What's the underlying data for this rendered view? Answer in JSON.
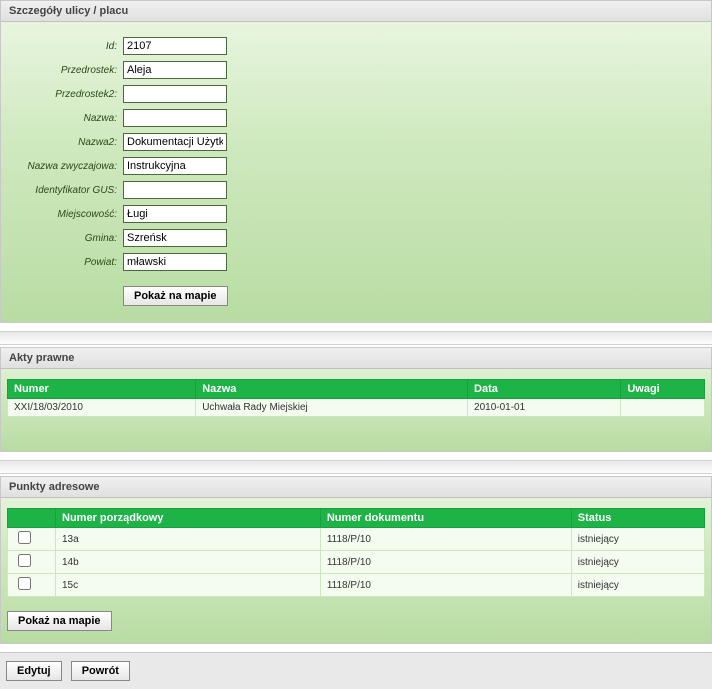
{
  "details": {
    "header": "Szczegóły ulicy / placu",
    "fields": {
      "id": {
        "label": "Id:",
        "value": "2107"
      },
      "prefix": {
        "label": "Przedrostek:",
        "value": "Aleja"
      },
      "prefix2": {
        "label": "Przedrostek2:",
        "value": ""
      },
      "name": {
        "label": "Nazwa:",
        "value": ""
      },
      "name2": {
        "label": "Nazwa2:",
        "value": "Dokumentacji Użytkowni"
      },
      "common": {
        "label": "Nazwa zwyczajowa:",
        "value": "Instrukcyjna"
      },
      "gus": {
        "label": "Identyfikator GUS:",
        "value": ""
      },
      "locality": {
        "label": "Miejscowość:",
        "value": "Ługi"
      },
      "gmina": {
        "label": "Gmina:",
        "value": "Szreńsk"
      },
      "powiat": {
        "label": "Powiat:",
        "value": "mławski"
      }
    },
    "show_map": "Pokaż na mapie"
  },
  "acts": {
    "header": "Akty prawne",
    "columns": {
      "numer": "Numer",
      "nazwa": "Nazwa",
      "data": "Data",
      "uwagi": "Uwagi"
    },
    "rows": [
      {
        "numer": "XXI/18/03/2010",
        "nazwa": "Uchwała Rady Miejskiej",
        "data": "2010-01-01",
        "uwagi": ""
      }
    ]
  },
  "addresses": {
    "header": "Punkty adresowe",
    "columns": {
      "check": "",
      "porzadkowy": "Numer porządkowy",
      "dokument": "Numer dokumentu",
      "status": "Status"
    },
    "rows": [
      {
        "porzadkowy": "13a",
        "dokument": "1118/P/10",
        "status": "istniejący"
      },
      {
        "porzadkowy": "14b",
        "dokument": "1118/P/10",
        "status": "istniejący"
      },
      {
        "porzadkowy": "15c",
        "dokument": "1118/P/10",
        "status": "istniejący"
      }
    ],
    "show_map": "Pokaż na mapie"
  },
  "footer": {
    "edit": "Edytuj",
    "back": "Powrót"
  }
}
